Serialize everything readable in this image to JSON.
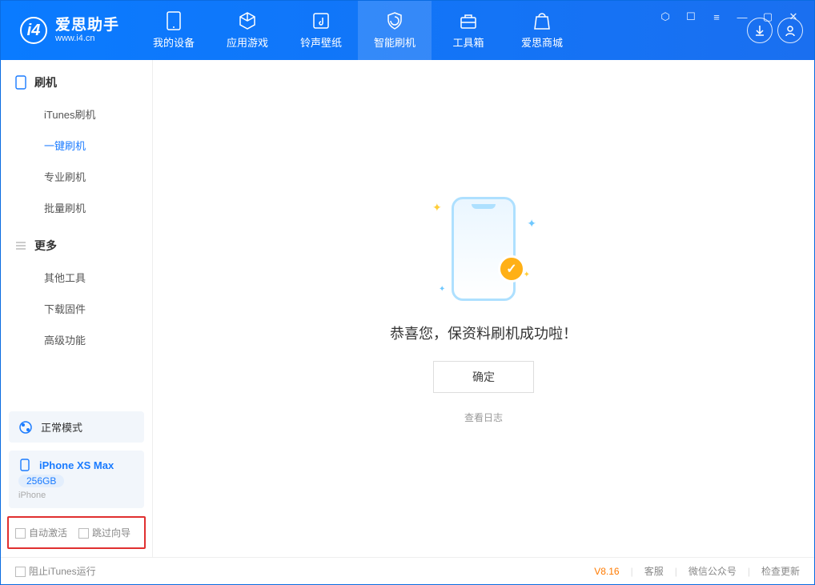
{
  "app": {
    "name": "爱思助手",
    "url": "www.i4.cn"
  },
  "nav": {
    "tabs": [
      {
        "label": "我的设备"
      },
      {
        "label": "应用游戏"
      },
      {
        "label": "铃声壁纸"
      },
      {
        "label": "智能刷机"
      },
      {
        "label": "工具箱"
      },
      {
        "label": "爱思商城"
      }
    ],
    "active_index": 3
  },
  "sidebar": {
    "section1": {
      "title": "刷机",
      "items": [
        "iTunes刷机",
        "一键刷机",
        "专业刷机",
        "批量刷机"
      ],
      "active_index": 1
    },
    "section2": {
      "title": "更多",
      "items": [
        "其他工具",
        "下载固件",
        "高级功能"
      ]
    },
    "mode_card": {
      "label": "正常模式"
    },
    "device_card": {
      "name": "iPhone XS Max",
      "storage": "256GB",
      "type": "iPhone"
    },
    "options": {
      "opt1": "自动激活",
      "opt2": "跳过向导"
    }
  },
  "main": {
    "success_msg": "恭喜您，保资料刷机成功啦！",
    "ok_btn": "确定",
    "log_link": "查看日志"
  },
  "status": {
    "block_itunes": "阻止iTunes运行",
    "version": "V8.16",
    "links": [
      "客服",
      "微信公众号",
      "检查更新"
    ]
  }
}
